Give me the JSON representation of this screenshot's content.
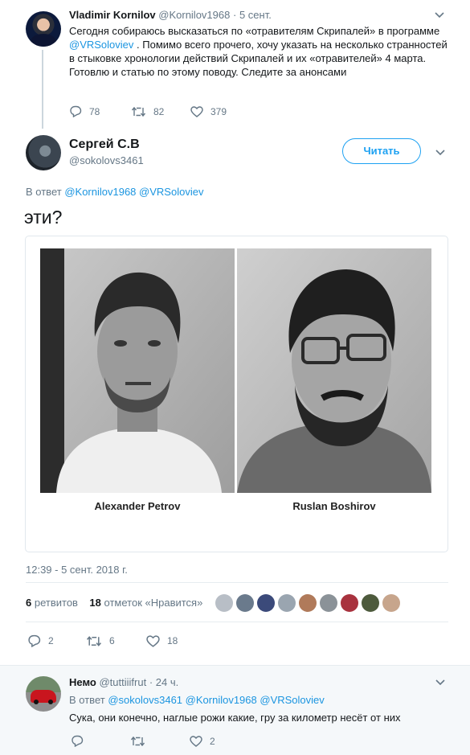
{
  "parent_tweet": {
    "author_name": "Vladimir Kornilov",
    "author_handle": "@Kornilov1968",
    "time": "5 сент.",
    "text_parts": [
      "Сегодня собираюсь высказаться по «отравителям Скрипалей» в программе ",
      "@VRSoloviev",
      " . Помимо всего прочего, хочу указать на несколько странностей в стыковке хронологии действий Скрипалей и их «отравителей» 4 марта."
    ],
    "text_line2": "Готовлю и статью по этому поводу. Следите за анонсами",
    "replies": "78",
    "retweets": "82",
    "likes": "379"
  },
  "main_tweet": {
    "author_name": "Сергей С.В",
    "author_handle": "@sokolovs3461",
    "follow_label": "Читать",
    "reply_prefix": "В ответ",
    "reply_mentions": [
      "@Kornilov1968",
      "@VRSoloviev"
    ],
    "text": "эти?",
    "image_captions": [
      "Alexander Petrov",
      "Ruslan Boshirov"
    ],
    "timestamp": "12:39 - 5 сент. 2018 г.",
    "retweets_count": "6",
    "retweets_label": "ретвитов",
    "likes_count": "18",
    "likes_label": "отметок «Нравится»",
    "actions": {
      "replies": "2",
      "retweets": "6",
      "likes": "18"
    }
  },
  "reply_tweet": {
    "author_name": "Немо",
    "author_handle": "@tuttiiifrut",
    "time": "24 ч.",
    "reply_prefix": "В ответ",
    "reply_mentions": [
      "@sokolovs3461",
      "@Kornilov1968",
      "@VRSoloviev"
    ],
    "text": "Сука, они конечно, наглые рожи какие, гру за километр несёт от них",
    "replies": "",
    "retweets": "",
    "likes": "2"
  },
  "icons": {
    "reply": "reply-icon",
    "retweet": "retweet-icon",
    "like": "heart-icon",
    "menu": "chevron-down-icon"
  },
  "colors": {
    "link": "#1b95e0",
    "muted": "#657786",
    "follow": "#1da1f2",
    "reply_background": "#f5f8fa"
  }
}
